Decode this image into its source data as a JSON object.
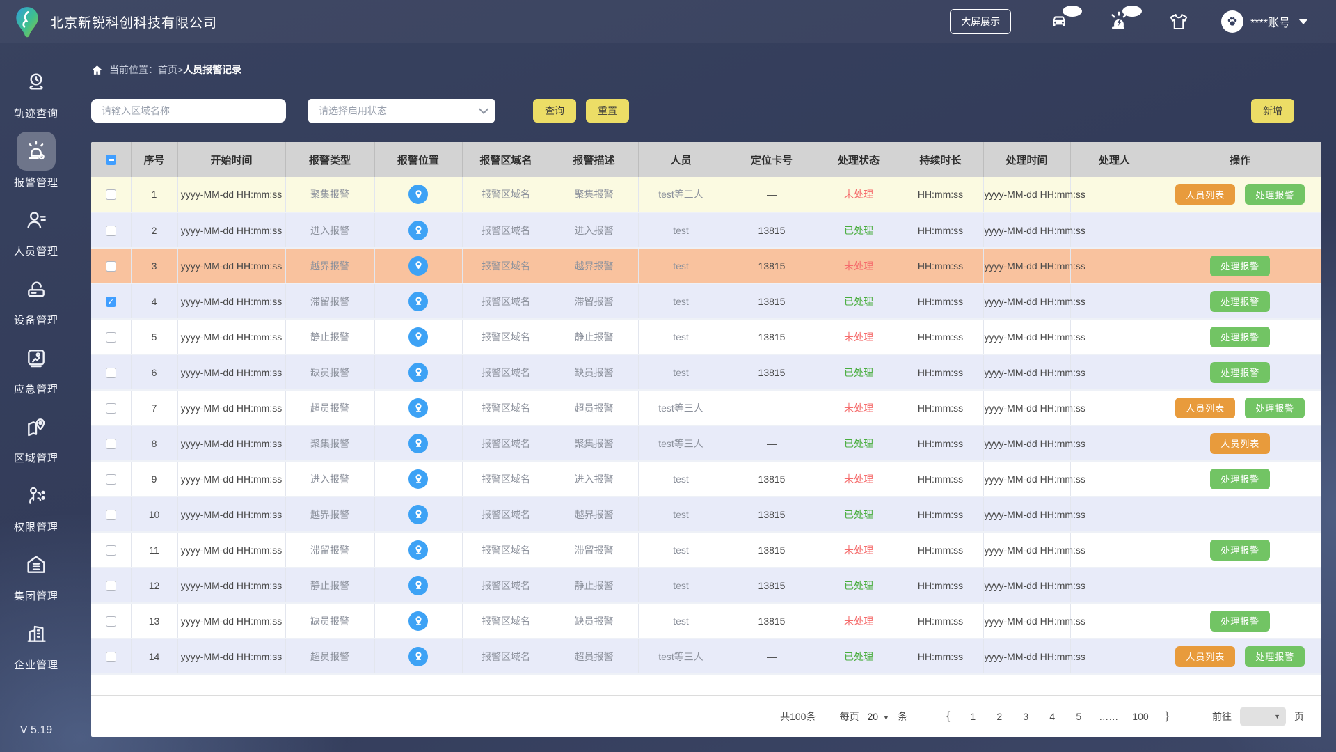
{
  "header": {
    "company_name": "北京新锐科创科技有限公司",
    "big_screen_button": "大屏展示",
    "account_label": "****账号"
  },
  "sidebar": {
    "items": [
      {
        "label": "轨迹查询",
        "active": false
      },
      {
        "label": "报警管理",
        "active": true
      },
      {
        "label": "人员管理",
        "active": false
      },
      {
        "label": "设备管理",
        "active": false
      },
      {
        "label": "应急管理",
        "active": false
      },
      {
        "label": "区域管理",
        "active": false
      },
      {
        "label": "权限管理",
        "active": false
      },
      {
        "label": "集团管理",
        "active": false
      },
      {
        "label": "企业管理",
        "active": false
      }
    ],
    "version": "V 5.19"
  },
  "breadcrumb": {
    "prefix": "当前位置：首页>",
    "current": "人员报警记录"
  },
  "filters": {
    "area_placeholder": "请输入区域名称",
    "status_placeholder": "请选择启用状态",
    "search_label": "查询",
    "reset_label": "重置",
    "add_label": "新增"
  },
  "table": {
    "headers": [
      "序号",
      "开始时间",
      "报警类型",
      "报警位置",
      "报警区域名",
      "报警描述",
      "人员",
      "定位卡号",
      "处理状态",
      "持续时长",
      "处理时间",
      "处理人",
      "操作"
    ],
    "action_labels": {
      "person_list": "人员列表",
      "handle": "处理报警"
    },
    "rows": [
      {
        "index": "1",
        "checked": false,
        "style": "yellow",
        "start_time": "yyyy-MM-dd HH:mm:ss",
        "alarm_type": "聚集报警",
        "area_name": "报警区域名",
        "description": "聚集报警",
        "person": "test等三人",
        "card_no": "—",
        "status": "未处理",
        "status_key": "unhandled",
        "duration": "HH:mm:ss",
        "handle_time": "yyyy-MM-dd HH:mm:ss",
        "handler": "",
        "actions": [
          "person_list",
          "handle"
        ]
      },
      {
        "index": "2",
        "checked": false,
        "style": "lavender",
        "start_time": "yyyy-MM-dd HH:mm:ss",
        "alarm_type": "进入报警",
        "area_name": "报警区域名",
        "description": "进入报警",
        "person": "test",
        "card_no": "13815",
        "status": "已处理",
        "status_key": "handled",
        "duration": "HH:mm:ss",
        "handle_time": "yyyy-MM-dd HH:mm:ss",
        "handler": "",
        "actions": []
      },
      {
        "index": "3",
        "checked": false,
        "style": "salmon",
        "start_time": "yyyy-MM-dd HH:mm:ss",
        "alarm_type": "越界报警",
        "area_name": "报警区域名",
        "description": "越界报警",
        "person": "test",
        "card_no": "13815",
        "status": "未处理",
        "status_key": "unhandled",
        "duration": "HH:mm:ss",
        "handle_time": "yyyy-MM-dd HH:mm:ss",
        "handler": "",
        "actions": [
          "handle"
        ]
      },
      {
        "index": "4",
        "checked": true,
        "style": "lavender",
        "start_time": "yyyy-MM-dd HH:mm:ss",
        "alarm_type": "滞留报警",
        "area_name": "报警区域名",
        "description": "滞留报警",
        "person": "test",
        "card_no": "13815",
        "status": "已处理",
        "status_key": "handled",
        "duration": "HH:mm:ss",
        "handle_time": "yyyy-MM-dd HH:mm:ss",
        "handler": "",
        "actions": [
          "handle"
        ]
      },
      {
        "index": "5",
        "checked": false,
        "style": "white",
        "start_time": "yyyy-MM-dd HH:mm:ss",
        "alarm_type": "静止报警",
        "area_name": "报警区域名",
        "description": "静止报警",
        "person": "test",
        "card_no": "13815",
        "status": "未处理",
        "status_key": "unhandled",
        "duration": "HH:mm:ss",
        "handle_time": "yyyy-MM-dd HH:mm:ss",
        "handler": "",
        "actions": [
          "handle"
        ]
      },
      {
        "index": "6",
        "checked": false,
        "style": "lavender",
        "start_time": "yyyy-MM-dd HH:mm:ss",
        "alarm_type": "缺员报警",
        "area_name": "报警区域名",
        "description": "缺员报警",
        "person": "test",
        "card_no": "13815",
        "status": "已处理",
        "status_key": "handled",
        "duration": "HH:mm:ss",
        "handle_time": "yyyy-MM-dd HH:mm:ss",
        "handler": "",
        "actions": [
          "handle"
        ]
      },
      {
        "index": "7",
        "checked": false,
        "style": "white",
        "start_time": "yyyy-MM-dd HH:mm:ss",
        "alarm_type": "超员报警",
        "area_name": "报警区域名",
        "description": "超员报警",
        "person": "test等三人",
        "card_no": "—",
        "status": "未处理",
        "status_key": "unhandled",
        "duration": "HH:mm:ss",
        "handle_time": "yyyy-MM-dd HH:mm:ss",
        "handler": "",
        "actions": [
          "person_list",
          "handle"
        ]
      },
      {
        "index": "8",
        "checked": false,
        "style": "lavender",
        "start_time": "yyyy-MM-dd HH:mm:ss",
        "alarm_type": "聚集报警",
        "area_name": "报警区域名",
        "description": "聚集报警",
        "person": "test等三人",
        "card_no": "—",
        "status": "已处理",
        "status_key": "handled",
        "duration": "HH:mm:ss",
        "handle_time": "yyyy-MM-dd HH:mm:ss",
        "handler": "",
        "actions": [
          "person_list"
        ]
      },
      {
        "index": "9",
        "checked": false,
        "style": "white",
        "start_time": "yyyy-MM-dd HH:mm:ss",
        "alarm_type": "进入报警",
        "area_name": "报警区域名",
        "description": "进入报警",
        "person": "test",
        "card_no": "13815",
        "status": "未处理",
        "status_key": "unhandled",
        "duration": "HH:mm:ss",
        "handle_time": "yyyy-MM-dd HH:mm:ss",
        "handler": "",
        "actions": [
          "handle"
        ]
      },
      {
        "index": "10",
        "checked": false,
        "style": "lavender",
        "start_time": "yyyy-MM-dd HH:mm:ss",
        "alarm_type": "越界报警",
        "area_name": "报警区域名",
        "description": "越界报警",
        "person": "test",
        "card_no": "13815",
        "status": "已处理",
        "status_key": "handled",
        "duration": "HH:mm:ss",
        "handle_time": "yyyy-MM-dd HH:mm:ss",
        "handler": "",
        "actions": []
      },
      {
        "index": "11",
        "checked": false,
        "style": "white",
        "start_time": "yyyy-MM-dd HH:mm:ss",
        "alarm_type": "滞留报警",
        "area_name": "报警区域名",
        "description": "滞留报警",
        "person": "test",
        "card_no": "13815",
        "status": "未处理",
        "status_key": "unhandled",
        "duration": "HH:mm:ss",
        "handle_time": "yyyy-MM-dd HH:mm:ss",
        "handler": "",
        "actions": [
          "handle"
        ]
      },
      {
        "index": "12",
        "checked": false,
        "style": "lavender",
        "start_time": "yyyy-MM-dd HH:mm:ss",
        "alarm_type": "静止报警",
        "area_name": "报警区域名",
        "description": "静止报警",
        "person": "test",
        "card_no": "13815",
        "status": "已处理",
        "status_key": "handled",
        "duration": "HH:mm:ss",
        "handle_time": "yyyy-MM-dd HH:mm:ss",
        "handler": "",
        "actions": []
      },
      {
        "index": "13",
        "checked": false,
        "style": "white",
        "start_time": "yyyy-MM-dd HH:mm:ss",
        "alarm_type": "缺员报警",
        "area_name": "报警区域名",
        "description": "缺员报警",
        "person": "test",
        "card_no": "13815",
        "status": "未处理",
        "status_key": "unhandled",
        "duration": "HH:mm:ss",
        "handle_time": "yyyy-MM-dd HH:mm:ss",
        "handler": "",
        "actions": [
          "handle"
        ]
      },
      {
        "index": "14",
        "checked": false,
        "style": "lavender",
        "start_time": "yyyy-MM-dd HH:mm:ss",
        "alarm_type": "超员报警",
        "area_name": "报警区域名",
        "description": "超员报警",
        "person": "test等三人",
        "card_no": "—",
        "status": "已处理",
        "status_key": "handled",
        "duration": "HH:mm:ss",
        "handle_time": "yyyy-MM-dd HH:mm:ss",
        "handler": "",
        "actions": [
          "person_list",
          "handle"
        ]
      }
    ]
  },
  "pagination": {
    "total_label": "共100条",
    "per_page_prefix": "每页",
    "per_page_value": "20",
    "per_page_suffix": "条",
    "prev_label": "{",
    "next_label": "}",
    "pages": [
      "1",
      "2",
      "3",
      "4",
      "5",
      "……",
      "100"
    ],
    "goto_label": "前往",
    "goto_suffix": "页"
  },
  "colors": {
    "accent_yellow": "#ecdd66",
    "action_orange": "#e89b3c",
    "action_green": "#72c464",
    "status_unhandled_red": "#f56c6c",
    "status_handled_green": "#49ad3e",
    "checkbox_blue": "#409eff",
    "location_pin_blue": "#3da2f5",
    "row_highlight_yellow": "#fbfae1",
    "row_highlight_salmon": "#f9c29e",
    "row_alt_lavender": "#e8ebf9"
  }
}
